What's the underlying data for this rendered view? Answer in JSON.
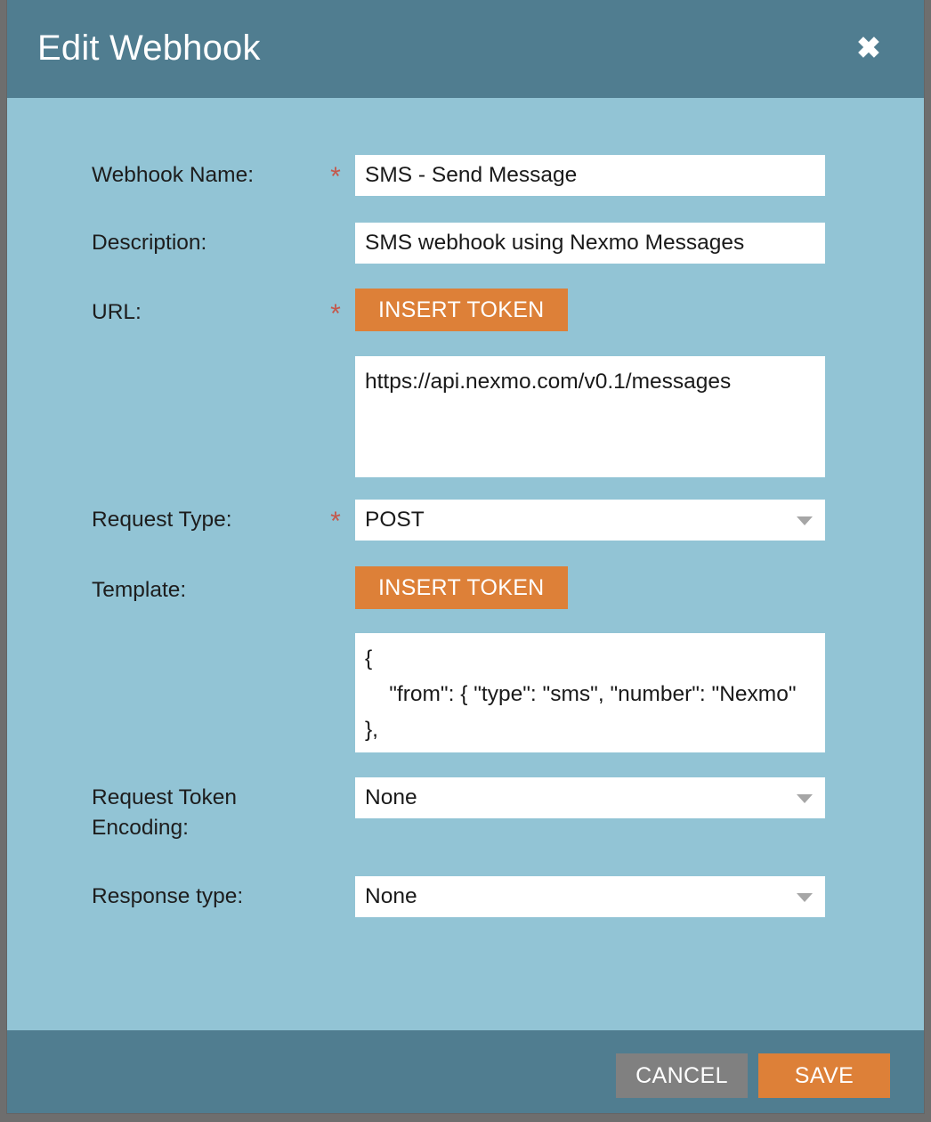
{
  "colors": {
    "header_bar": "#507d90",
    "body_background": "#92c4d5",
    "accent_orange": "#dd8038",
    "cancel_gray": "#808080",
    "required_star": "#c4584c",
    "page_backdrop": "#6e6e6e"
  },
  "dialog": {
    "title": "Edit Webhook",
    "close_icon": "close-icon",
    "required_marker": "*"
  },
  "fields": {
    "webhook_name": {
      "label": "Webhook Name:",
      "required": true,
      "value": "SMS - Send Message"
    },
    "description": {
      "label": "Description:",
      "required": false,
      "value": "SMS webhook using Nexmo Messages"
    },
    "url": {
      "label": "URL:",
      "required": true,
      "insert_token_label": "INSERT TOKEN",
      "value": "https://api.nexmo.com/v0.1/messages"
    },
    "request_type": {
      "label": "Request Type:",
      "required": true,
      "value": "POST"
    },
    "template": {
      "label": "Template:",
      "insert_token_label": "INSERT TOKEN",
      "value": "{\n    \"from\": { \"type\": \"sms\", \"number\": \"Nexmo\" },\n    \"to\": { \"type\": \"sms\", \"number\": \"\" },"
    },
    "request_token_encoding": {
      "label": "Request Token\nEncoding:",
      "value": "None"
    },
    "response_type": {
      "label": "Response type:",
      "value": "None"
    }
  },
  "footer": {
    "cancel_label": "CANCEL",
    "save_label": "SAVE"
  }
}
